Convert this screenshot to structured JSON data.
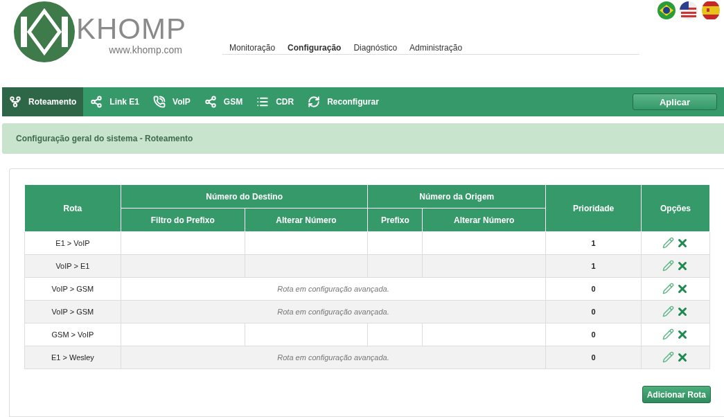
{
  "logo": {
    "name": "KHOMP",
    "url": "www.khomp.com"
  },
  "languages": [
    {
      "kind": "br"
    },
    {
      "kind": "us"
    },
    {
      "kind": "es"
    }
  ],
  "top_nav": [
    {
      "label": "Monitoração",
      "selected": false
    },
    {
      "label": "Configuração",
      "selected": true
    },
    {
      "label": "Diagnóstico",
      "selected": false
    },
    {
      "label": "Administração",
      "selected": false
    }
  ],
  "tabs": [
    {
      "label": "Roteamento",
      "kind": "route",
      "selected": true
    },
    {
      "label": "Link E1",
      "kind": "link",
      "selected": false
    },
    {
      "label": "VoIP",
      "kind": "voip",
      "selected": false
    },
    {
      "label": "GSM",
      "kind": "link",
      "selected": false
    },
    {
      "label": "CDR",
      "kind": "list",
      "selected": false
    },
    {
      "label": "Reconfigurar",
      "kind": "refresh",
      "selected": false
    }
  ],
  "apply_button": "Aplicar",
  "page_title": "Configuração geral do sistema - Roteamento",
  "table": {
    "columns": {
      "route": "Rota",
      "dest_group": "Número do Destino",
      "dest_prefix": "Filtro do Prefixo",
      "dest_change": "Alterar Número",
      "orig_group": "Número da Origem",
      "orig_prefix": "Prefixo",
      "orig_change": "Alterar Número",
      "priority": "Prioridade",
      "options": "Opções"
    },
    "rows": [
      {
        "kind": "plain",
        "route": "E1 > VoIP",
        "priority": "1"
      },
      {
        "kind": "plain",
        "route": "VoIP > E1",
        "priority": "1"
      },
      {
        "kind": "advanced",
        "route": "VoIP > GSM",
        "note": "Rota em configuração avançada.",
        "priority": "0"
      },
      {
        "kind": "advanced",
        "route": "VoIP > GSM",
        "note": "Rota em configuração avançada.",
        "priority": "0"
      },
      {
        "kind": "plain",
        "route": "GSM > VoIP",
        "priority": "0"
      },
      {
        "kind": "advanced",
        "route": "E1 > Wesley",
        "note": "Rota em configuração avançada.",
        "priority": "0"
      }
    ]
  },
  "add_button": "Adicionar Rota"
}
